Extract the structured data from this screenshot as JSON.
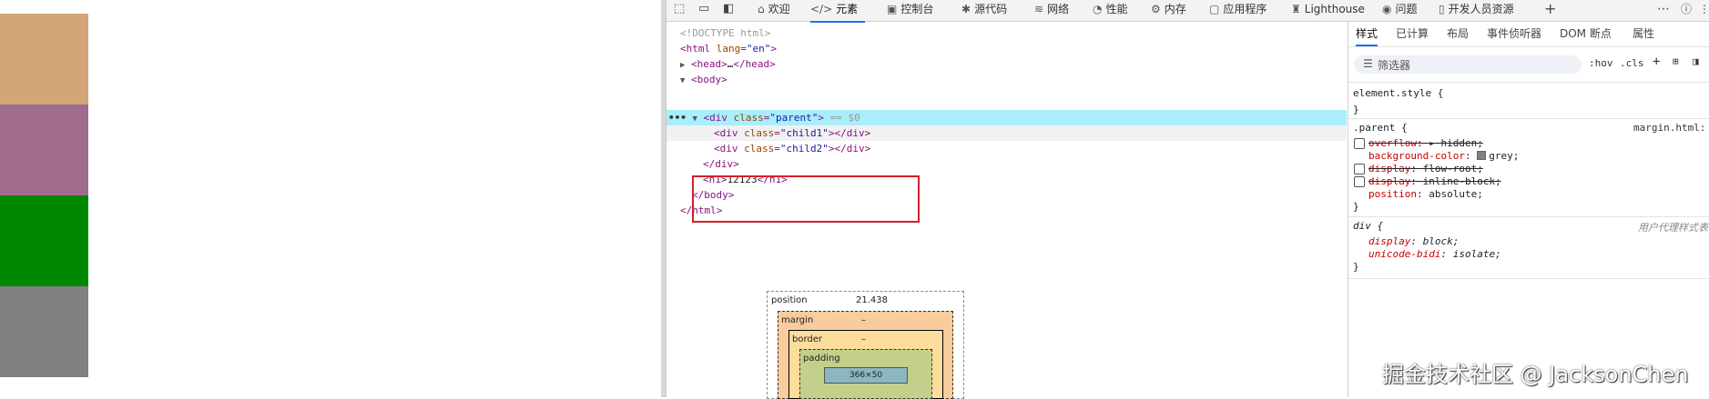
{
  "toolbar": {
    "tabs": [
      {
        "icon": "house-icon",
        "label": "欢迎"
      },
      {
        "icon": "code-icon",
        "label": "元素"
      },
      {
        "icon": "console-icon",
        "label": "控制台"
      },
      {
        "icon": "bug-icon",
        "label": "源代码"
      },
      {
        "icon": "wifi-icon",
        "label": "网络"
      },
      {
        "icon": "gauge-icon",
        "label": "性能"
      },
      {
        "icon": "memory-icon",
        "label": "内存"
      },
      {
        "icon": "app-icon",
        "label": "应用程序"
      },
      {
        "icon": "lighthouse-icon",
        "label": "Lighthouse"
      },
      {
        "icon": "bulb-icon",
        "label": "问题"
      },
      {
        "icon": "device-icon",
        "label": "开发人员资源"
      }
    ],
    "active_tab": "元素"
  },
  "dom": {
    "doctype": "<!DOCTYPE html>",
    "html_open_tag": "html",
    "html_attr": "lang",
    "html_attr_val": "\"en\"",
    "head_tag": "<head>",
    "head_close": "</head>",
    "body_open": "<body>",
    "div_parent_open": "<div ",
    "div_parent_attr": "class",
    "div_parent_val": "\"parent\"",
    "div_parent_suffix": " == $0",
    "child1_attr_val": "\"child1\"",
    "child2_attr_val": "\"child2\"",
    "div_close": "</div>",
    "h1_open": "<h1>",
    "h1_text": "12123",
    "h1_close": "</h1>",
    "body_close": "</body>",
    "html_close": "</html>",
    "ellipsis": "•••"
  },
  "styles": {
    "tabs": [
      "样式",
      "已计算",
      "布局",
      "事件侦听器",
      "DOM 断点",
      "属性"
    ],
    "filter_placeholder": "筛选器",
    "hov": ":hov",
    "cls": ".cls",
    "element_style": "element.style {",
    "close_brace": "}",
    "parent_selector": ".parent {",
    "parent_source": "margin.html:",
    "rules": [
      {
        "prop": "overflow",
        "value": "hidden;",
        "struck": true,
        "checkbox": true
      },
      {
        "prop": "background-color",
        "value": "grey;",
        "struck": false,
        "checkbox": false,
        "swatch": "#808080"
      },
      {
        "prop": "display",
        "value": "flow-root;",
        "struck": true,
        "checkbox": true
      },
      {
        "prop": "display",
        "value": "inline-block;",
        "struck": true,
        "checkbox": true
      },
      {
        "prop": "position",
        "value": "absolute;",
        "struck": false,
        "checkbox": false
      }
    ],
    "div_selector": "div {",
    "ua_label": "用户代理样式表",
    "div_rules": [
      {
        "prop": "display",
        "value": "block;"
      },
      {
        "prop": "unicode-bidi",
        "value": "isolate;"
      }
    ]
  },
  "box_model": {
    "position_label": "position",
    "position_value": "21.438",
    "margin_label": "margin",
    "margin_value": "–",
    "border_label": "border",
    "border_value": "–",
    "padding_label": "padding",
    "content_value": "366×50"
  },
  "watermark": "掘金技术社区 @ JacksonChen",
  "colors": {
    "block1": "#d2a679",
    "block2": "#a06c8e",
    "block3": "#008700",
    "block4": "#808080",
    "selected_row": "#a8eefc",
    "highlight_box": "#d42027",
    "accent": "#1a73e8"
  }
}
